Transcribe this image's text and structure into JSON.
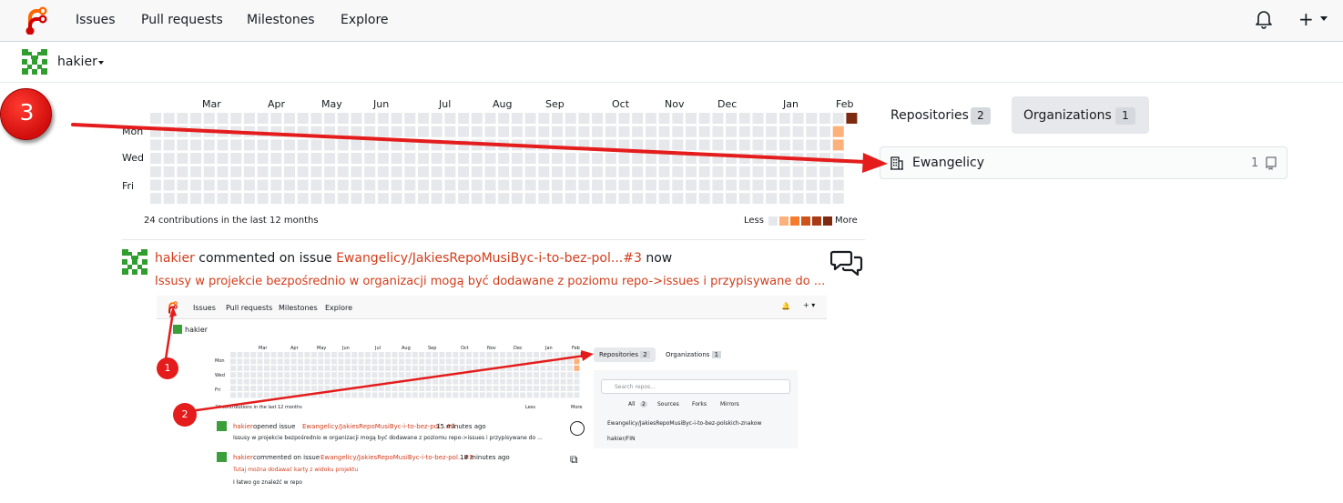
{
  "navbar": {
    "links": [
      "Issues",
      "Pull requests",
      "Milestones",
      "Explore"
    ],
    "icons": [
      "forgejo-logo-icon",
      "bell-icon",
      "plus-icon"
    ]
  },
  "context": {
    "username": "hakier"
  },
  "heatmap": {
    "months": [
      "Mar",
      "Apr",
      "May",
      "Jun",
      "Jul",
      "Aug",
      "Sep",
      "Oct",
      "Nov",
      "Dec",
      "Jan",
      "Feb"
    ],
    "day_labels": [
      "Mon",
      "Wed",
      "Fri"
    ],
    "total_text": "24 contributions in the last 12 months",
    "legend_less": "Less",
    "legend_more": "More",
    "legend_colors": [
      "#e6e8eb",
      "#fdb17a",
      "#f57c2e",
      "#d0521b",
      "#a83a14",
      "#7e2a10"
    ],
    "empty_color": "#e6e8eb",
    "active_cells": [
      {
        "col": 52,
        "row": 0,
        "level": 5
      },
      {
        "col": 51,
        "row": 1,
        "level": 1
      },
      {
        "col": 51,
        "row": 2,
        "level": 1
      }
    ]
  },
  "feed": {
    "actor": "hakier",
    "action": "commented on issue",
    "target": "Ewangelicy/JakiesRepoMusiByc-i-to-bez-pol...#3",
    "time": "now",
    "preview": "Issusy w projekcie bezpośrednio w organizacji mogą być dodawane z poziomu repo->issues i przypisywane do ...",
    "screenshot": {
      "nav_links": [
        "Issues",
        "Pull requests",
        "Milestones",
        "Explore"
      ],
      "username": "hakier",
      "months": [
        "Mar",
        "Apr",
        "May",
        "Jun",
        "Jul",
        "Aug",
        "Sep",
        "Oct",
        "Nov",
        "Dec",
        "Jan",
        "Feb"
      ],
      "day_labels": [
        "Mon",
        "Wed",
        "Fri"
      ],
      "total_text": "24 contributions in the last 12 months",
      "legend_less": "Less",
      "legend_more": "More",
      "tab_repos": "Repositories",
      "tab_repos_count": "2",
      "tab_orgs": "Organizations",
      "tab_orgs_count": "1",
      "search_placeholder": "Search repos...",
      "filters": [
        "All",
        "Sources",
        "Forks",
        "Mirrors"
      ],
      "filter_all_count": "2",
      "repos": [
        "Ewangelicy/JakiesRepoMusiByc-i-to-bez-polskich-znakow",
        "hakier/FIN"
      ],
      "items": [
        {
          "actor": "hakier",
          "action": "opened issue",
          "target": "Ewangelicy/JakiesRepoMusiByc-i-to-bez-pol...#3",
          "time": "15 minutes ago",
          "preview": "Issusy w projekcie bezpośrednio w organizacji mogą być dodawane z poziomu repo->issues i przypisywane do ..."
        },
        {
          "actor": "hakier",
          "action": "commented on issue",
          "target": "Ewangelicy/JakiesRepoMusiByc-i-to-bez-pol...#2",
          "time": "18 minutes ago",
          "preview": "Tutaj można dodawać karty z widoku projektu",
          "extra": "I łatwo go znaleźć w repo"
        }
      ],
      "badges": [
        "1",
        "2"
      ]
    }
  },
  "right": {
    "tab_repos": "Repositories",
    "tab_repos_count": "2",
    "tab_orgs": "Organizations",
    "tab_orgs_count": "1",
    "org_name": "Ewangelicy",
    "org_repo_count": "1"
  },
  "annotation": {
    "badge": "3",
    "color": "#e41c1c"
  },
  "colors": {
    "accent": "#d23d1b",
    "text": "#181c21",
    "navbar_bg": "#f8f8f9"
  }
}
